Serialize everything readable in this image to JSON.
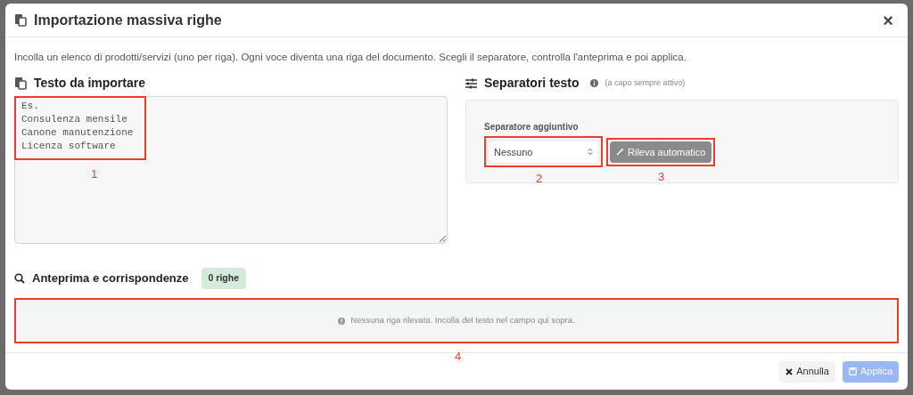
{
  "dialog": {
    "title": "Importazione massiva righe",
    "close": "×",
    "intro": "Incolla un elenco di prodotti/servizi (uno per riga). Ogni voce diventa una riga del documento. Scegli il separatore, controlla l'anteprima e poi applica."
  },
  "import_text": {
    "heading": "Testo da importare",
    "placeholder": "Es.\nConsulenza mensile\nCanone manutenzione\nLicenza software"
  },
  "separators": {
    "heading": "Separatori testo",
    "hint": "(a capo sempre attivo)",
    "field_label": "Separatore aggiuntivo",
    "select_value": "Nessuno",
    "detect_button": {
      "label": "Rileva automatico",
      "disabled": true
    }
  },
  "preview": {
    "heading": "Anteprima e corrispondenze",
    "count_badge": "0 righe",
    "empty_message": "Nessuna riga rilevata. Incolla del testo nel campo qui sopra."
  },
  "footer": {
    "buttons": [
      {
        "label": "Annulla",
        "kind": "cancel",
        "disabled": false
      },
      {
        "label": "Applica",
        "kind": "apply",
        "disabled": true
      }
    ]
  },
  "annotations": [
    "1",
    "2",
    "3",
    "4"
  ]
}
